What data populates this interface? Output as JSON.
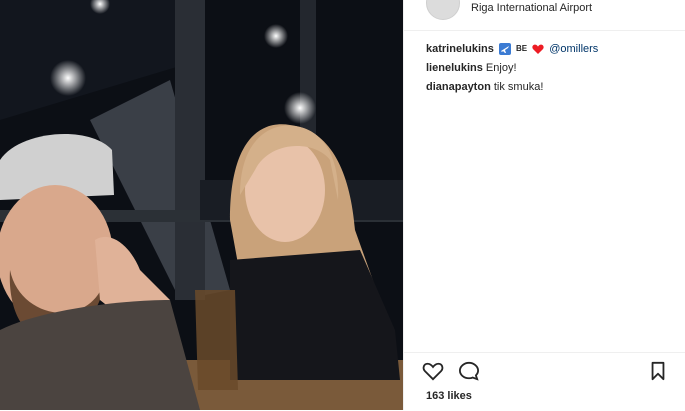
{
  "post": {
    "location": "Riga International Airport",
    "comments": [
      {
        "user": "katrinelukins",
        "emoji_text": "BE",
        "mention": "@omillers",
        "text": ""
      },
      {
        "user": "lienelukins",
        "text": "Enjoy!"
      },
      {
        "user": "dianapayton",
        "text": "tik smuka!"
      }
    ],
    "likes": "163 likes"
  },
  "icons": [
    "airplane-icon",
    "heart-icon",
    "like-icon",
    "comment-icon",
    "save-icon"
  ],
  "colors": {
    "text": "#262626",
    "mention": "#003569",
    "heart": "#ed1c24",
    "border": "#efefef"
  }
}
